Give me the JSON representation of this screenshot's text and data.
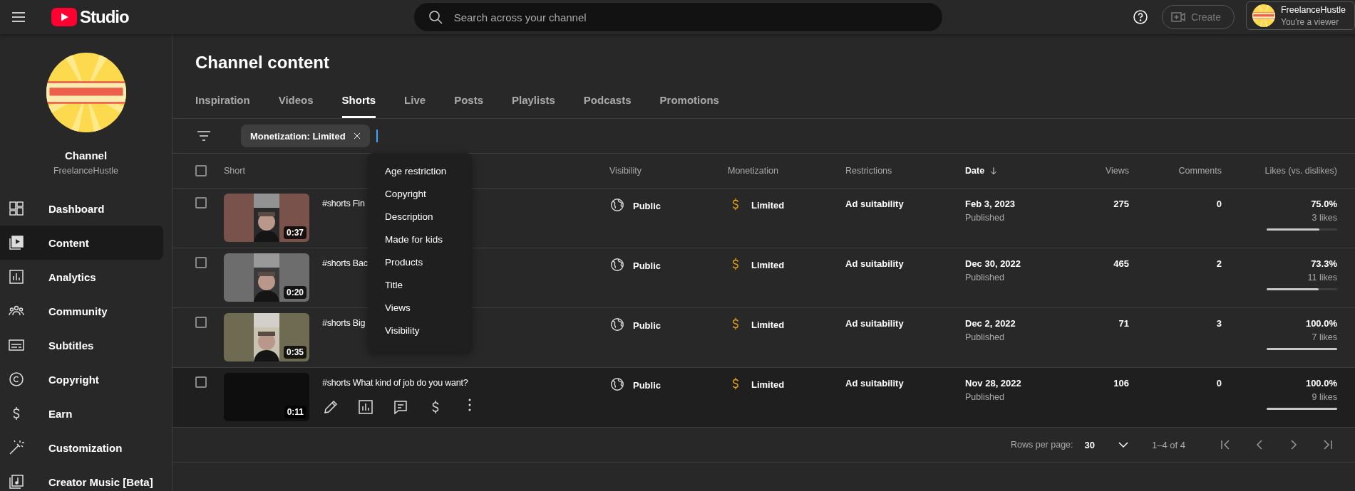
{
  "header": {
    "logo_text": "Studio",
    "search": {
      "placeholder": "Search across your channel"
    },
    "create": {
      "label": "Create",
      "disabled": true
    },
    "account": {
      "name": "FreelanceHustle",
      "role": "You're a viewer"
    }
  },
  "sidebar": {
    "channel_label": "Channel",
    "handle": "FreelanceHustle",
    "items": [
      {
        "label": "Dashboard",
        "kind": "dashboard",
        "selected": false
      },
      {
        "label": "Content",
        "kind": "content",
        "selected": true
      },
      {
        "label": "Analytics",
        "kind": "analytics",
        "selected": false
      },
      {
        "label": "Community",
        "kind": "community",
        "selected": false
      },
      {
        "label": "Subtitles",
        "kind": "subtitles",
        "selected": false
      },
      {
        "label": "Copyright",
        "kind": "copyright",
        "selected": false
      },
      {
        "label": "Earn",
        "kind": "earn",
        "selected": false
      },
      {
        "label": "Customization",
        "kind": "customization",
        "selected": false
      },
      {
        "label": "Creator Music [Beta]",
        "kind": "music",
        "selected": false
      }
    ]
  },
  "page_title": "Channel content",
  "tabs": [
    {
      "label": "Inspiration",
      "selected": false
    },
    {
      "label": "Videos",
      "selected": false
    },
    {
      "label": "Shorts",
      "selected": true
    },
    {
      "label": "Live",
      "selected": false
    },
    {
      "label": "Posts",
      "selected": false
    },
    {
      "label": "Playlists",
      "selected": false
    },
    {
      "label": "Podcasts",
      "selected": false
    },
    {
      "label": "Promotions",
      "selected": false
    }
  ],
  "filter": {
    "chips": [
      {
        "label": "Monetization: Limited"
      }
    ]
  },
  "filter_menu": {
    "items": [
      "Age restriction",
      "Copyright",
      "Description",
      "Made for kids",
      "Products",
      "Title",
      "Views",
      "Visibility"
    ]
  },
  "table": {
    "select_all": {
      "checked": false
    },
    "columns": [
      {
        "label": "Short",
        "sorted": false
      },
      {
        "label": "Visibility",
        "sorted": false
      },
      {
        "label": "Monetization",
        "sorted": false
      },
      {
        "label": "Restrictions",
        "sorted": false
      },
      {
        "label": "Date",
        "sorted": true
      },
      {
        "label": "Views",
        "sorted": false
      },
      {
        "label": "Comments",
        "sorted": false
      },
      {
        "label": "Likes (vs. dislikes)",
        "sorted": false
      }
    ],
    "rows": [
      {
        "checked": false,
        "title": "#shorts Fin",
        "duration": "0:37",
        "visibility": "Public",
        "monetization": "Limited",
        "restrictions": "Ad suitability",
        "date": "Feb 3, 2023",
        "status": "Published",
        "views": "275",
        "comments": "0",
        "likes_pct": "75.0%",
        "likes_count": "3 likes",
        "level": 0.75,
        "hovered": false
      },
      {
        "checked": false,
        "title": "#shorts Bac",
        "duration": "0:20",
        "visibility": "Public",
        "monetization": "Limited",
        "restrictions": "Ad suitability",
        "date": "Dec 30, 2022",
        "status": "Published",
        "views": "465",
        "comments": "2",
        "likes_pct": "73.3%",
        "likes_count": "11 likes",
        "level": 0.733,
        "hovered": false
      },
      {
        "checked": false,
        "title": "#shorts Big",
        "duration": "0:35",
        "visibility": "Public",
        "monetization": "Limited",
        "restrictions": "Ad suitability",
        "date": "Dec 2, 2022",
        "status": "Published",
        "views": "71",
        "comments": "3",
        "likes_pct": "100.0%",
        "likes_count": "7 likes",
        "level": 1,
        "hovered": false
      },
      {
        "checked": false,
        "title": "#shorts What kind of job do you want?",
        "duration": "0:11",
        "visibility": "Public",
        "monetization": "Limited",
        "restrictions": "Ad suitability",
        "date": "Nov 28, 2022",
        "status": "Published",
        "views": "106",
        "comments": "0",
        "likes_pct": "100.0%",
        "likes_count": "9 likes",
        "level": 1,
        "hovered": true
      }
    ]
  },
  "pagination": {
    "label": "Rows per page:",
    "value": "30",
    "range": "1–4 of 4"
  }
}
